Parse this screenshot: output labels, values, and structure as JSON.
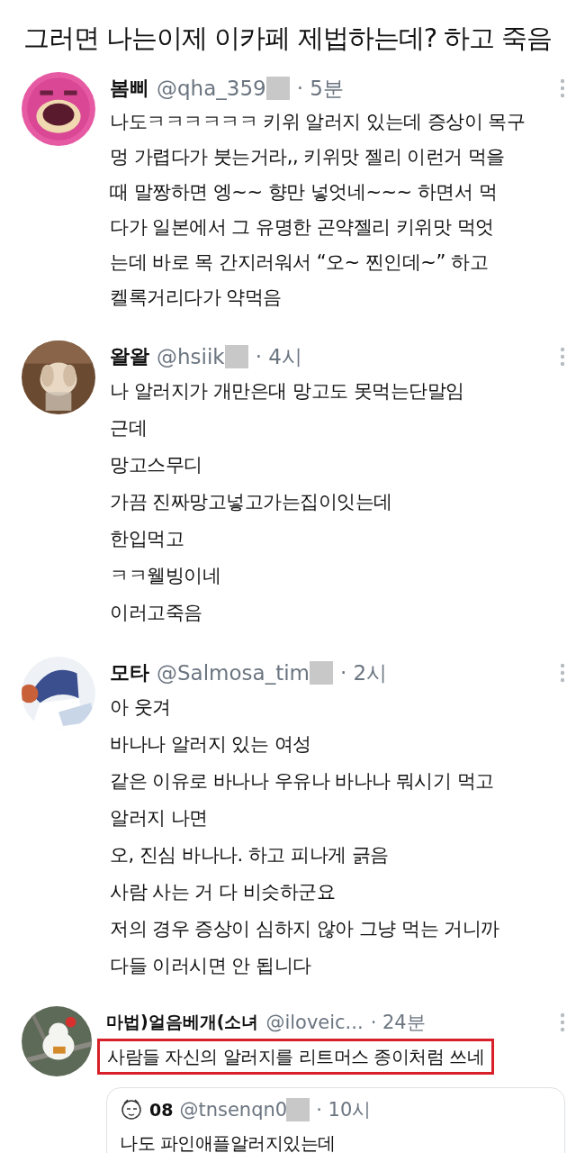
{
  "heading": "그러면 나는이제 이카페 제법하는데? 하고 죽음",
  "tweets": [
    {
      "name": "봄삐",
      "handle": "@qha_359",
      "redacted": true,
      "time": "· 5분",
      "highlighted": false,
      "lines": [
        "나도ㅋㅋㅋㅋㅋㅋ 키위 알러지 있는데 증상이 목구",
        "멍 가렵다가 붓는거라,, 키위맛 젤리 이런거 먹을",
        "때 말짱하면 엥~~ 향만 넣엇네~~~ 하면서 먹",
        "다가 일본에서 그 유명한 곤약젤리 키위맛 먹엇",
        "는데 바로 목 간지러워서 “오~ 찐인데~” 하고",
        "켈록거리다가 약먹음"
      ]
    },
    {
      "name": "왈왈",
      "handle": "@hsiik",
      "redacted": true,
      "time": "· 4시",
      "highlighted": false,
      "lines": [
        "나 알러지가 개만은대 망고도 못먹는단말임",
        "근데",
        "망고스무디",
        "가끔 진짜망고넣고가는집이잇는데",
        "한입먹고",
        "ㅋㅋ웰빙이네",
        "이러고죽음"
      ]
    },
    {
      "name": "모타",
      "handle": "@Salmosa_tim",
      "redacted": true,
      "time": "· 2시",
      "highlighted": false,
      "lines": [
        "아 웃겨",
        "바나나 알러지 있는 여성",
        "같은 이유로 바나나 우유나 바나나 뭐시기 먹고",
        "알러지 나면",
        "오, 진심 바나나. 하고 피나게 긁음",
        "사람 사는 거 다 비슷하군요",
        "저의 경우 증상이 심하지 않아 그냥 먹는 거니까",
        "다들 이러시면 안 됩니다"
      ]
    },
    {
      "name": "마법)얼음베개(소녀",
      "handle": "@iloveic...",
      "redacted": false,
      "time": "· 24분",
      "highlighted": true,
      "lines": [
        "사람들 자신의 알러지를 리트머스 종이처럼 쓰네"
      ],
      "quote": {
        "name": "08",
        "handle": "@tnsenqn0",
        "redacted": true,
        "time": "· 10시",
        "lines": [
          "나도 파인애플알러지있는데"
        ]
      }
    }
  ]
}
